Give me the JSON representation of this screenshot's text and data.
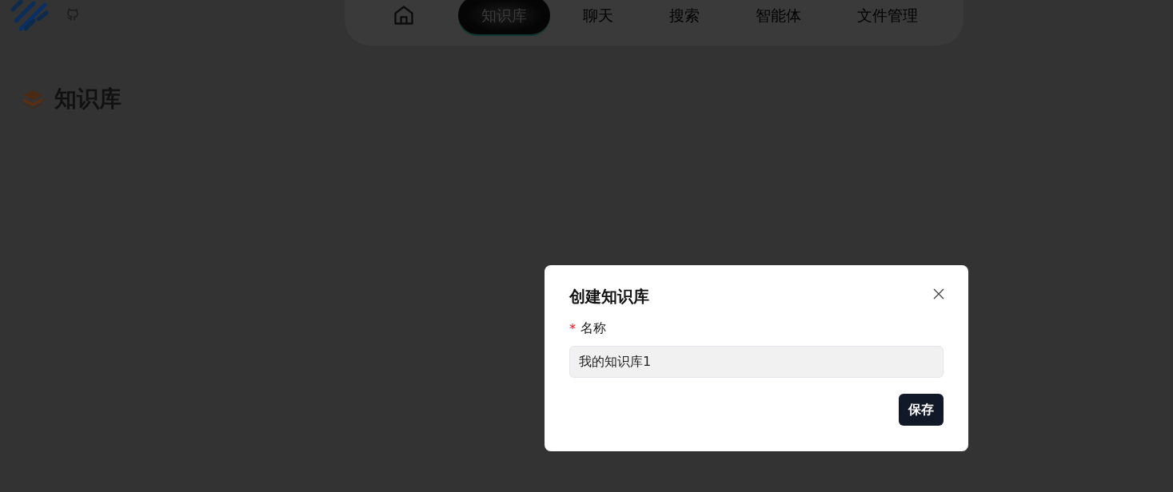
{
  "nav": {
    "tabs": [
      {
        "label": "知识库",
        "selected": true
      },
      {
        "label": "聊天",
        "selected": false
      },
      {
        "label": "搜索",
        "selected": false
      },
      {
        "label": "智能体",
        "selected": false
      },
      {
        "label": "文件管理",
        "selected": false
      }
    ]
  },
  "page": {
    "title": "知识库"
  },
  "dialog": {
    "title": "创建知识库",
    "field": {
      "label": "名称",
      "required": true,
      "required_mark": "*",
      "value": "我的知识库1"
    },
    "button": "保存"
  }
}
